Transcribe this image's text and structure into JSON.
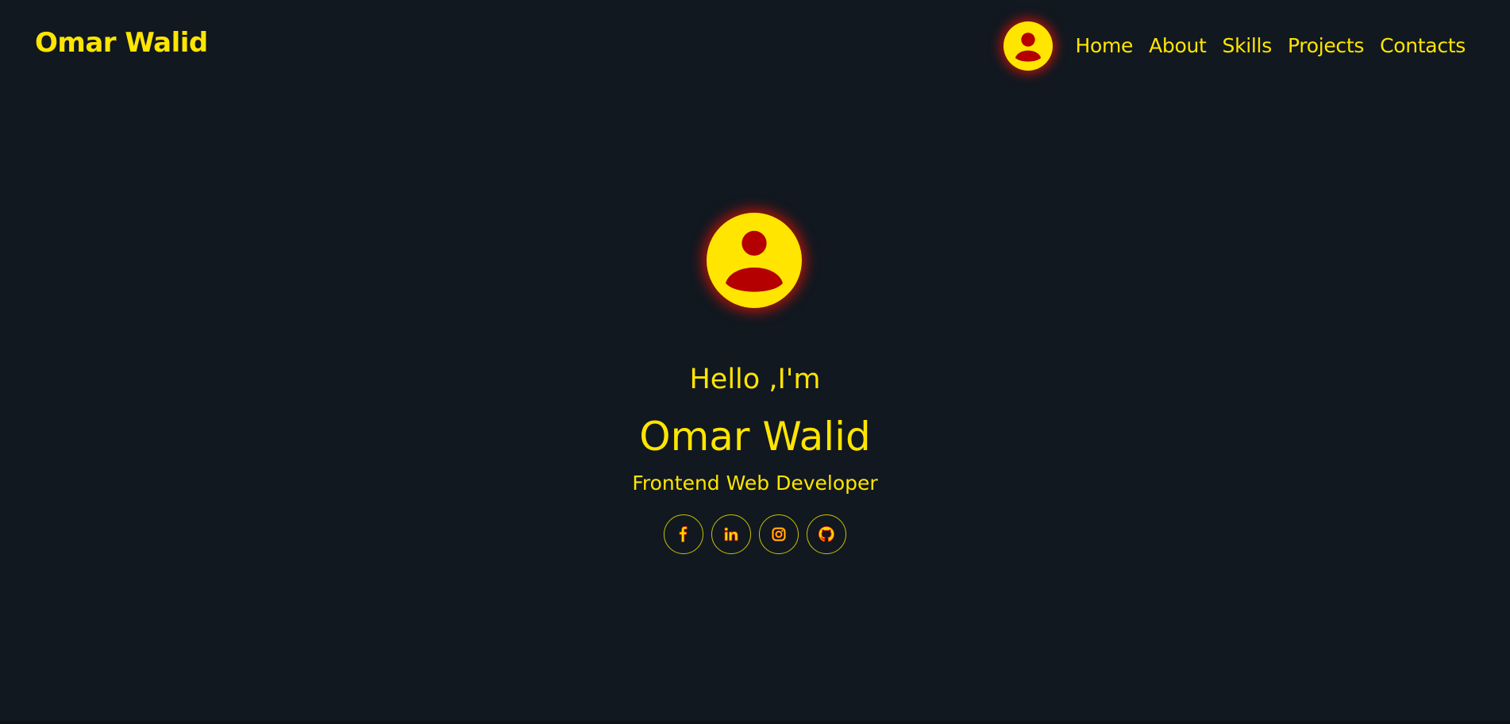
{
  "header": {
    "brand": "Omar Walid",
    "nav_avatar_icon": "user-avatar-icon",
    "nav": [
      {
        "label": "Home"
      },
      {
        "label": "About"
      },
      {
        "label": "Skills"
      },
      {
        "label": "Projects"
      },
      {
        "label": "Contacts"
      }
    ]
  },
  "hero": {
    "avatar_icon": "user-avatar-icon",
    "greeting": "Hello ,I'm",
    "name": "Omar Walid",
    "role": "Frontend Web Developer",
    "socials": [
      {
        "icon": "facebook-icon"
      },
      {
        "icon": "linkedin-icon"
      },
      {
        "icon": "instagram-icon"
      },
      {
        "icon": "github-icon"
      }
    ]
  },
  "theme": {
    "background": "#111820",
    "accent": "#ffe500",
    "glow": "#ff1400",
    "icon_dark": "#b40000"
  }
}
